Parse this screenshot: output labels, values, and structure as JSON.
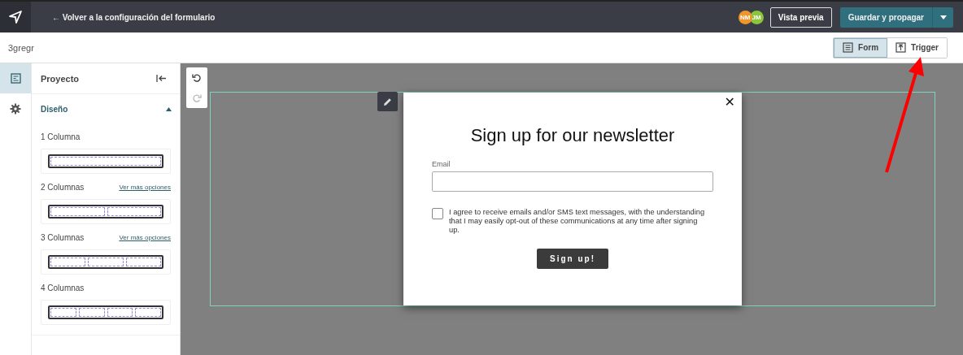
{
  "topbar": {
    "back_link": "← Volver a la configuración del formulario",
    "avatars": [
      {
        "initials": "NM",
        "color": "#f0952a"
      },
      {
        "initials": "JM",
        "color": "#8cc43c"
      }
    ],
    "preview_button": "Vista previa",
    "save_button": "Guardar y propagar"
  },
  "subbar": {
    "form_name": "3gregr",
    "view_toggle": [
      {
        "label": "Form",
        "kind": "form",
        "selected": true
      },
      {
        "label": "Trigger",
        "kind": "trigger",
        "selected": false
      }
    ]
  },
  "rail": [
    {
      "kind": "layout",
      "selected": true
    },
    {
      "kind": "settings",
      "selected": false
    }
  ],
  "panel": {
    "title": "Proyecto",
    "section": {
      "title": "Diseño",
      "expanded": true
    },
    "layouts": [
      {
        "label": "1 Columna",
        "kind": "col1"
      },
      {
        "label": "2 Columnas",
        "link": "Ver más opciones",
        "kind": "col2"
      },
      {
        "label": "3 Columnas",
        "link": "Ver más opciones",
        "kind": "col3"
      },
      {
        "label": "4 Columnas",
        "kind": "col4"
      }
    ]
  },
  "canvas": {
    "undo_enabled": true,
    "redo_enabled": false,
    "popup": {
      "close": "✕",
      "heading": "Sign up for our newsletter",
      "email_label": "Email",
      "consent_checked": false,
      "consent_text": "I agree to receive emails and/or SMS text messages, with the understanding that I may easily opt-out of these communications at any time after signing up.",
      "submit": "Sign up!"
    }
  }
}
